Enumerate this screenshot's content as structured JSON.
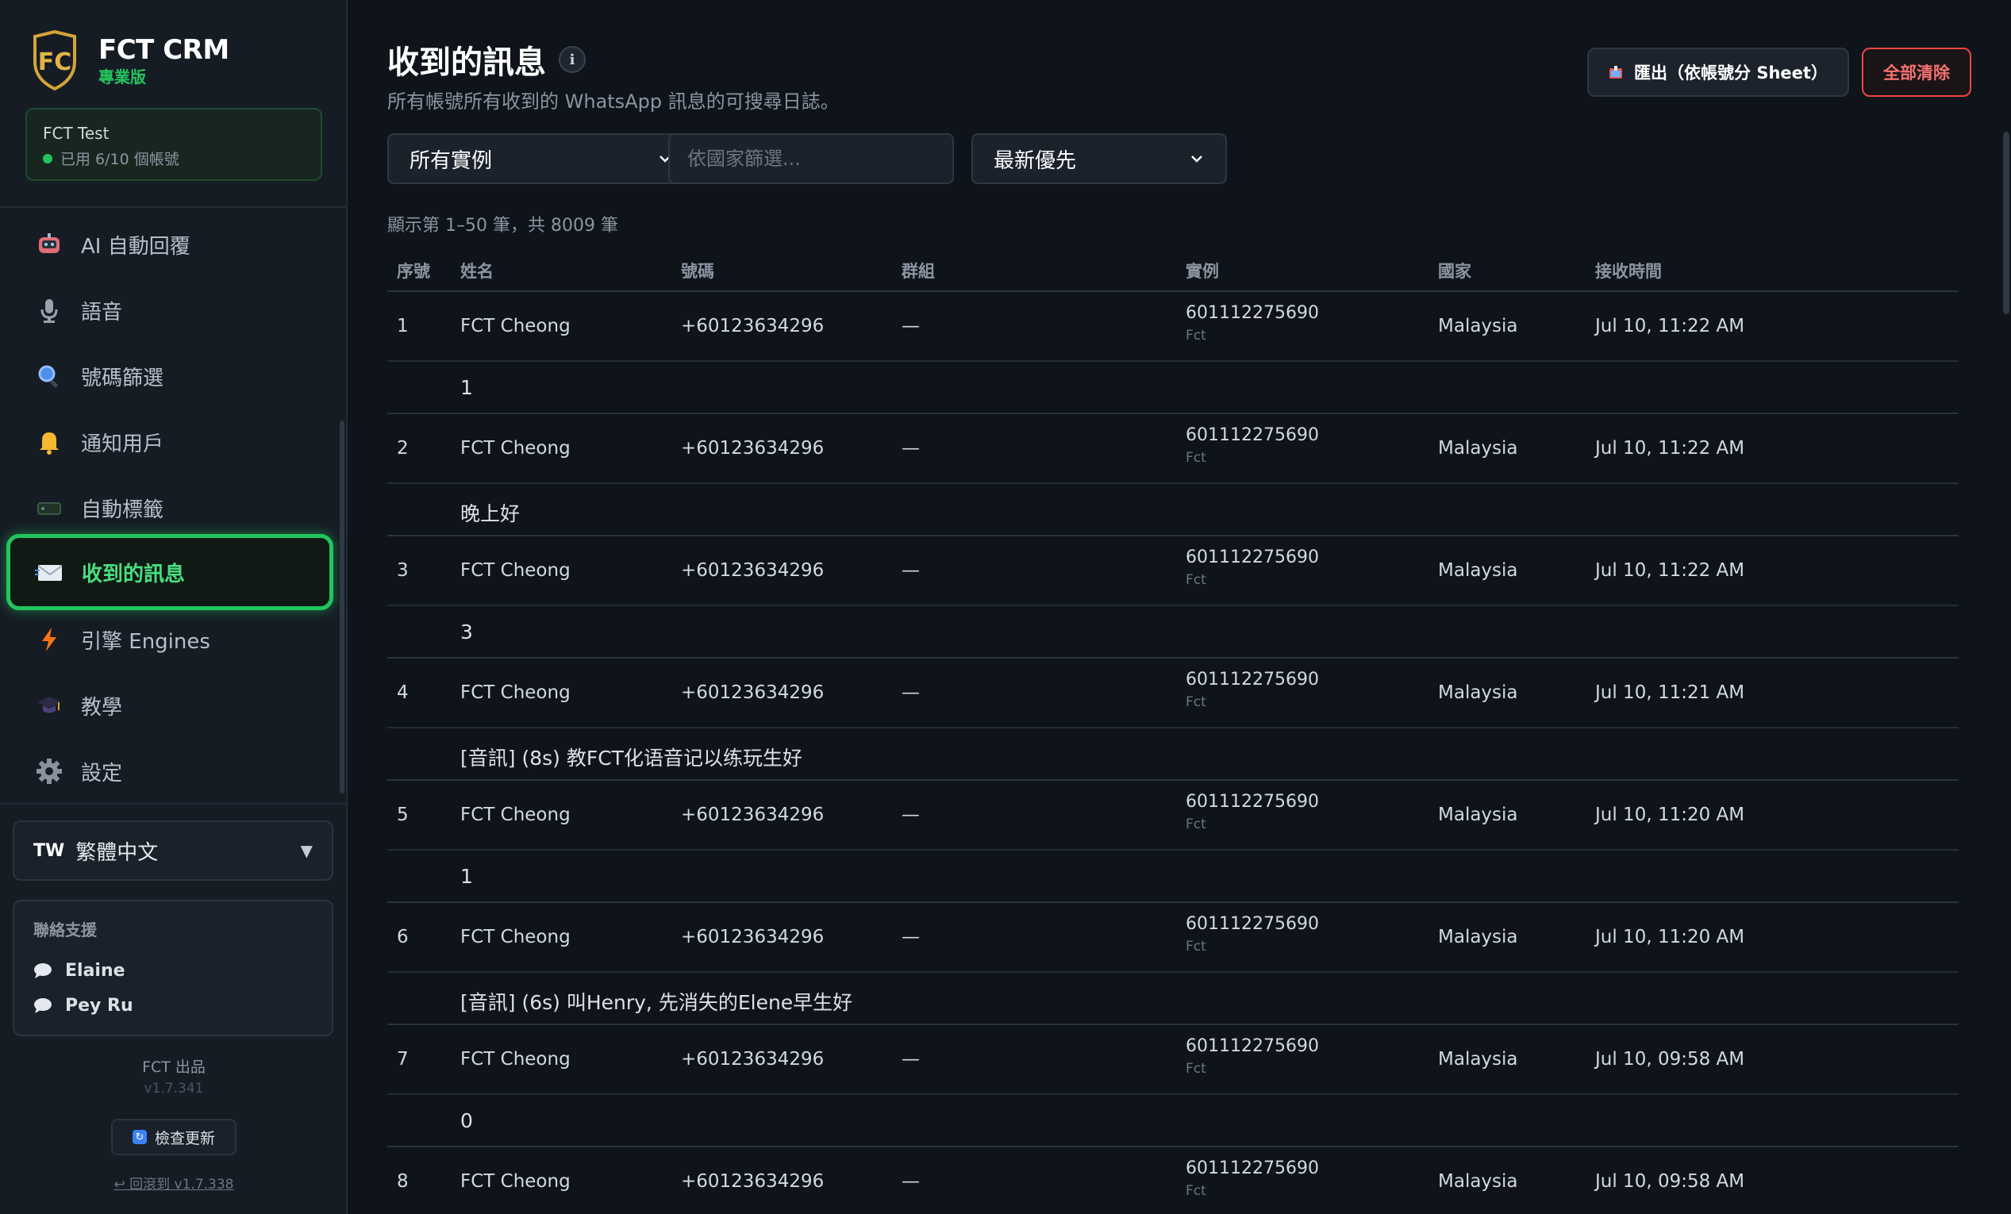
{
  "brand": {
    "title": "FCT CRM",
    "subtitle": "專業版",
    "logo_text": "FC"
  },
  "account": {
    "name": "FCT Test",
    "usage": "已用 6/10 個帳號"
  },
  "nav": [
    {
      "label": "AI 自動回覆",
      "icon": "robot-icon"
    },
    {
      "label": "語音",
      "icon": "microphone-icon"
    },
    {
      "label": "號碼篩選",
      "icon": "magnifier-icon"
    },
    {
      "label": "通知用戶",
      "icon": "bell-icon"
    },
    {
      "label": "自動標籤",
      "icon": "tag-icon"
    },
    {
      "label": "收到的訊息",
      "icon": "envelope-icon",
      "active": true
    },
    {
      "label": "引擎 Engines",
      "icon": "lightning-icon"
    },
    {
      "label": "教學",
      "icon": "graduation-cap-icon"
    },
    {
      "label": "設定",
      "icon": "gear-icon"
    }
  ],
  "language": {
    "code": "TW",
    "label": "繁體中文",
    "caret": "▼"
  },
  "support": {
    "title": "聯絡支援",
    "contacts": [
      "Elaine",
      "Pey Ru"
    ]
  },
  "footer": {
    "made_by": "FCT 出品",
    "version": "v1.7.341",
    "update_label": "檢查更新",
    "rollback_label": "↩ 回滾到 v1.7.338"
  },
  "header": {
    "title": "收到的訊息",
    "info_icon_glyph": "i",
    "subtitle": "所有帳號所有收到的 WhatsApp 訊息的可搜尋日誌。",
    "export_label": "匯出（依帳號分 Sheet）",
    "clear_label": "全部清除"
  },
  "filters": {
    "instance_value": "所有實例",
    "country_placeholder": "依國家篩選...",
    "sort_value": "最新優先"
  },
  "count_text": "顯示第 1–50 筆，共 8009 筆",
  "table": {
    "columns": [
      "序號",
      "姓名",
      "號碼",
      "群組",
      "實例",
      "國家",
      "接收時間"
    ],
    "rows": [
      {
        "no": "1",
        "name": "FCT Cheong",
        "phone": "+60123634296",
        "group": "—",
        "instance": "601112275690",
        "instance_sub": "Fct",
        "country": "Malaysia",
        "time": "Jul 10, 11:22 AM",
        "message": "1"
      },
      {
        "no": "2",
        "name": "FCT Cheong",
        "phone": "+60123634296",
        "group": "—",
        "instance": "601112275690",
        "instance_sub": "Fct",
        "country": "Malaysia",
        "time": "Jul 10, 11:22 AM",
        "message": "晚上好"
      },
      {
        "no": "3",
        "name": "FCT Cheong",
        "phone": "+60123634296",
        "group": "—",
        "instance": "601112275690",
        "instance_sub": "Fct",
        "country": "Malaysia",
        "time": "Jul 10, 11:22 AM",
        "message": "3"
      },
      {
        "no": "4",
        "name": "FCT Cheong",
        "phone": "+60123634296",
        "group": "—",
        "instance": "601112275690",
        "instance_sub": "Fct",
        "country": "Malaysia",
        "time": "Jul 10, 11:21 AM",
        "message": "[音訊] (8s) 教FCT化语音记以练玩生好"
      },
      {
        "no": "5",
        "name": "FCT Cheong",
        "phone": "+60123634296",
        "group": "—",
        "instance": "601112275690",
        "instance_sub": "Fct",
        "country": "Malaysia",
        "time": "Jul 10, 11:20 AM",
        "message": "1"
      },
      {
        "no": "6",
        "name": "FCT Cheong",
        "phone": "+60123634296",
        "group": "—",
        "instance": "601112275690",
        "instance_sub": "Fct",
        "country": "Malaysia",
        "time": "Jul 10, 11:20 AM",
        "message": "[音訊] (6s) 叫Henry, 先消失的Elene早生好"
      },
      {
        "no": "7",
        "name": "FCT Cheong",
        "phone": "+60123634296",
        "group": "—",
        "instance": "601112275690",
        "instance_sub": "Fct",
        "country": "Malaysia",
        "time": "Jul 10, 09:58 AM",
        "message": "0"
      },
      {
        "no": "8",
        "name": "FCT Cheong",
        "phone": "+60123634296",
        "group": "—",
        "instance": "601112275690",
        "instance_sub": "Fct",
        "country": "Malaysia",
        "time": "Jul 10, 09:58 AM",
        "message": ""
      }
    ]
  },
  "colors": {
    "accent": "#22c55e",
    "danger": "#ef4444",
    "background": "#0f141b",
    "sidebar": "#161c24"
  }
}
